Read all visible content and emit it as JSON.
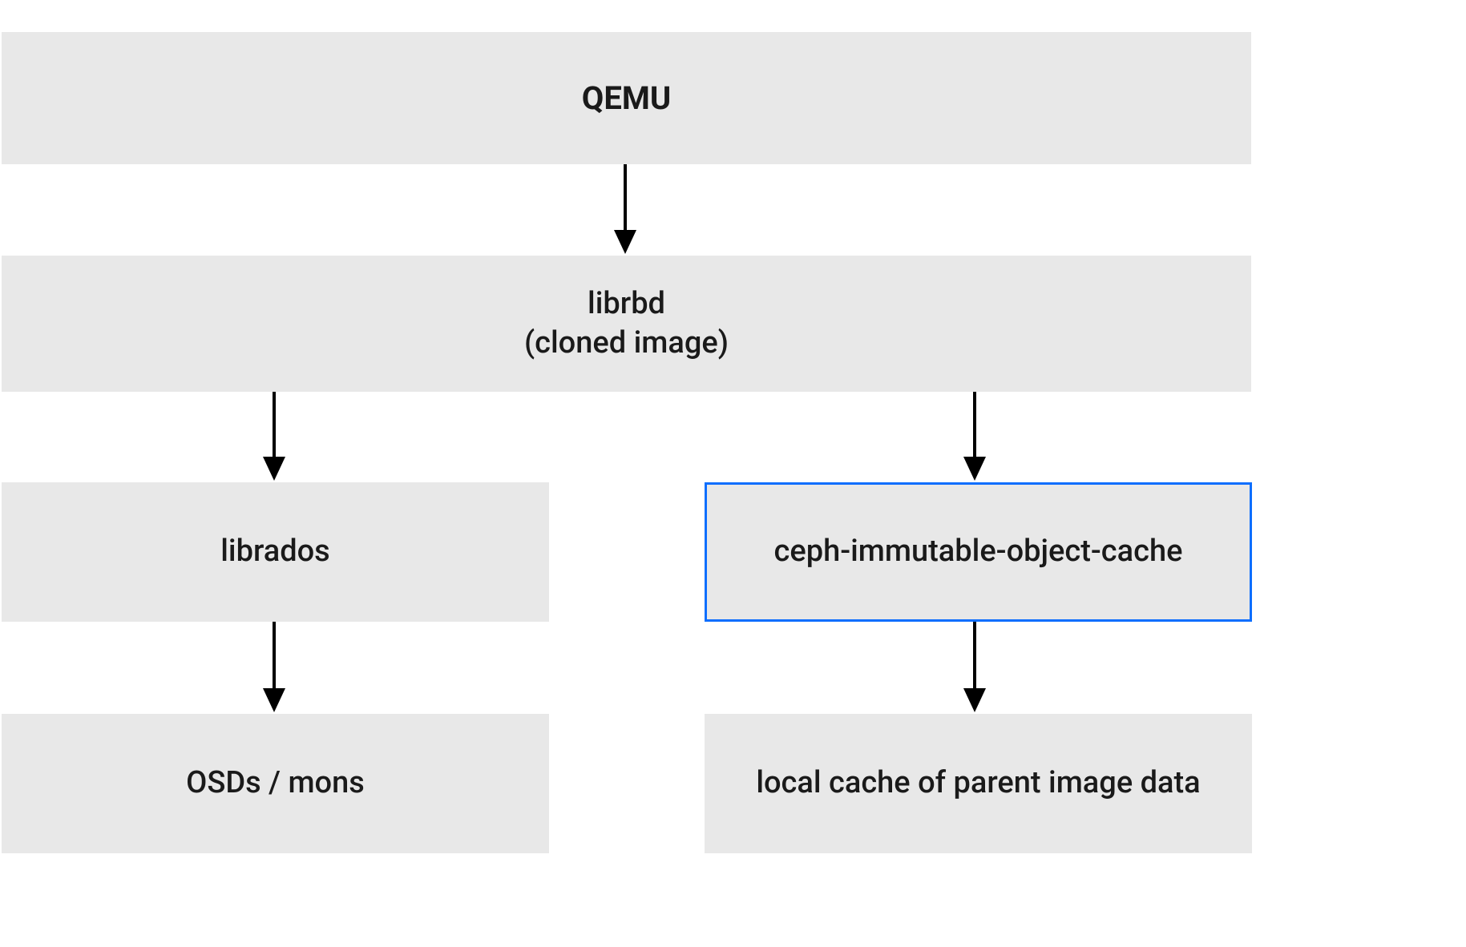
{
  "boxes": {
    "qemu": "QEMU",
    "librbd_line1": "librbd",
    "librbd_line2": "(cloned image)",
    "librados": "librados",
    "cache_daemon": "ceph-immutable-object-cache",
    "osds": "OSDs / mons",
    "local_cache": "local cache of parent image data"
  },
  "colors": {
    "box_bg": "#e8e8e8",
    "highlight_border": "#0d6efd",
    "text": "#1a1a1a",
    "arrow": "#000000"
  }
}
